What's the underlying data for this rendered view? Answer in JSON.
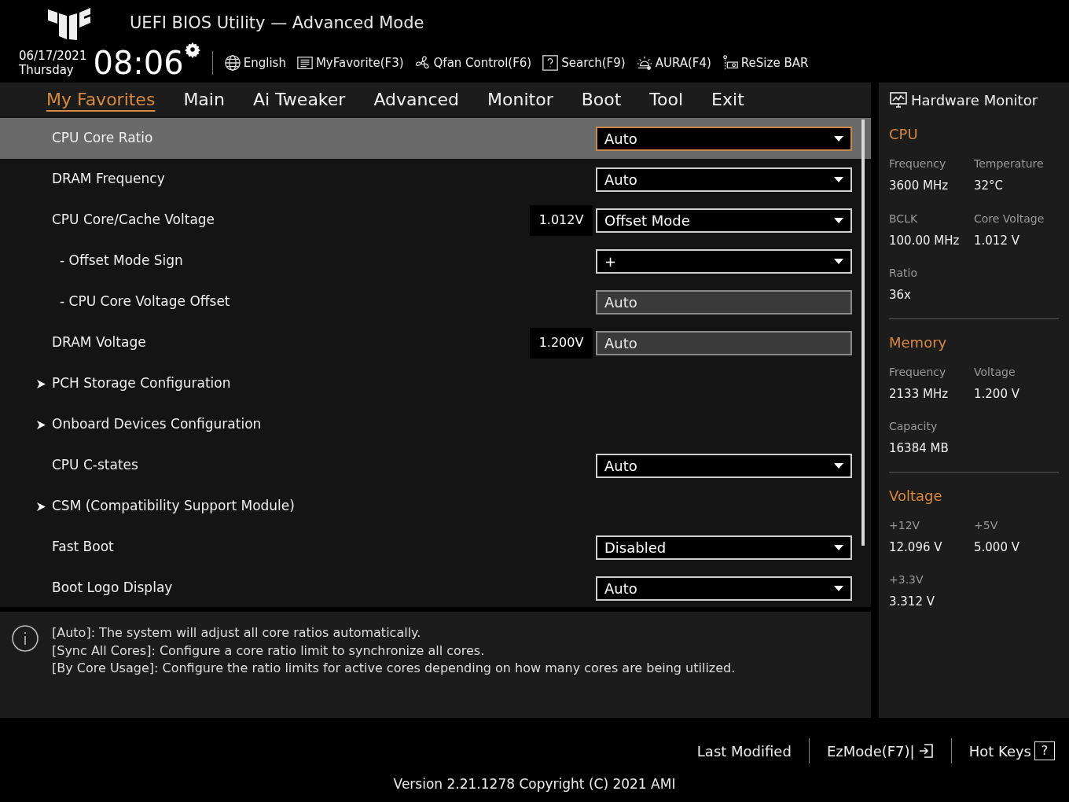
{
  "header": {
    "title": "UEFI BIOS Utility — Advanced Mode",
    "date": "06/17/2021",
    "day": "Thursday",
    "time": "08:06",
    "tools": [
      {
        "kind": "globe",
        "label": "English"
      },
      {
        "kind": "favorite",
        "label": "MyFavorite(F3)"
      },
      {
        "kind": "fan",
        "label": "Qfan Control(F6)"
      },
      {
        "kind": "search",
        "label": "Search(F9)"
      },
      {
        "kind": "aura",
        "label": "AURA(F4)"
      },
      {
        "kind": "resize",
        "label": "ReSize BAR"
      }
    ]
  },
  "tabs": [
    {
      "label": "My Favorites",
      "selected": true
    },
    {
      "label": "Main",
      "selected": false
    },
    {
      "label": "Ai Tweaker",
      "selected": false
    },
    {
      "label": "Advanced",
      "selected": false
    },
    {
      "label": "Monitor",
      "selected": false
    },
    {
      "label": "Boot",
      "selected": false
    },
    {
      "label": "Tool",
      "selected": false
    },
    {
      "label": "Exit",
      "selected": false
    }
  ],
  "settings": [
    {
      "kind": "dropdown",
      "label": "CPU Core Ratio",
      "value": "Auto",
      "selected": true
    },
    {
      "kind": "dropdown",
      "label": "DRAM Frequency",
      "value": "Auto",
      "selected": false
    },
    {
      "kind": "dropdown",
      "label": "CPU Core/Cache Voltage",
      "reading": "1.012V",
      "value": "Offset Mode",
      "selected": false,
      "children": [
        {
          "kind": "dropdown",
          "label": "- Offset Mode Sign",
          "value": "+",
          "selected": false
        },
        {
          "kind": "field",
          "label": "- CPU Core Voltage Offset",
          "value": "Auto",
          "selected": false
        }
      ]
    },
    {
      "kind": "field",
      "label": "DRAM Voltage",
      "reading": "1.200V",
      "value": "Auto",
      "selected": false
    },
    {
      "kind": "submenu",
      "label": "PCH Storage Configuration",
      "selected": false
    },
    {
      "kind": "submenu",
      "label": "Onboard Devices Configuration",
      "selected": false
    },
    {
      "kind": "dropdown",
      "label": "CPU C-states",
      "value": "Auto",
      "selected": false
    },
    {
      "kind": "submenu",
      "label": "CSM (Compatibility Support Module)",
      "selected": false
    },
    {
      "kind": "dropdown",
      "label": "Fast Boot",
      "value": "Disabled",
      "selected": false
    },
    {
      "kind": "dropdown",
      "label": "Boot Logo Display",
      "value": "Auto",
      "selected": false
    }
  ],
  "help": [
    "[Auto]: The system will adjust all core ratios automatically.",
    "[Sync All Cores]: Configure a core ratio limit to synchronize all cores.",
    "[By Core Usage]: Configure the ratio limits for active cores depending on how many cores are being utilized."
  ],
  "hardware_monitor": {
    "title": "Hardware Monitor",
    "sections": [
      {
        "title": "CPU",
        "fields": [
          {
            "label": "Frequency",
            "value": "3600 MHz"
          },
          {
            "label": "Temperature",
            "value": "32°C"
          },
          {
            "label": "BCLK",
            "value": "100.00 MHz"
          },
          {
            "label": "Core Voltage",
            "value": "1.012 V"
          },
          {
            "label": "Ratio",
            "value": "36x"
          }
        ]
      },
      {
        "title": "Memory",
        "fields": [
          {
            "label": "Frequency",
            "value": "2133 MHz"
          },
          {
            "label": "Voltage",
            "value": "1.200 V"
          },
          {
            "label": "Capacity",
            "value": "16384 MB"
          }
        ]
      },
      {
        "title": "Voltage",
        "fields": [
          {
            "label": "+12V",
            "value": "12.096 V"
          },
          {
            "label": "+5V",
            "value": "5.000 V"
          },
          {
            "label": "+3.3V",
            "value": "3.312 V"
          }
        ]
      }
    ]
  },
  "footer": {
    "buttons": [
      {
        "kind": "plain",
        "label": "Last Modified"
      },
      {
        "kind": "ezmode",
        "label": "EzMode(F7)|"
      },
      {
        "kind": "hotkeys",
        "label": "Hot Keys"
      }
    ],
    "hotkeys_icon": "?",
    "version": "Version 2.21.1278 Copyright (C) 2021 AMI"
  }
}
